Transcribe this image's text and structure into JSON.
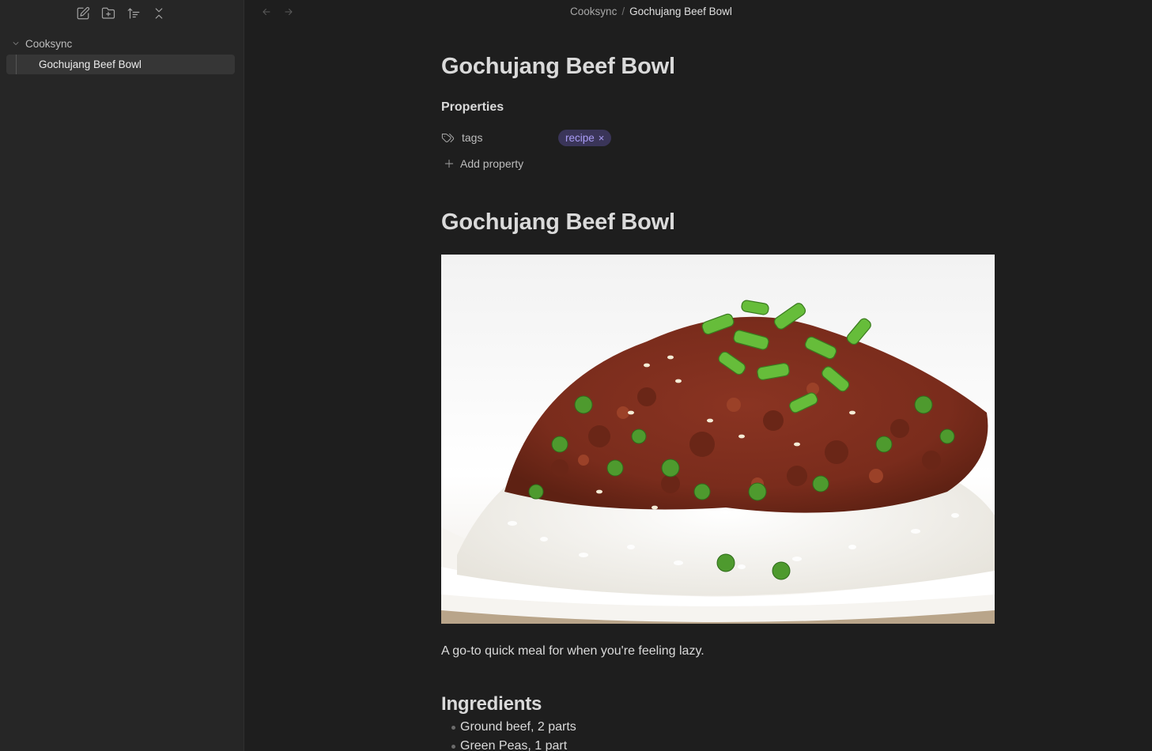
{
  "sidebar": {
    "toolbar": [
      {
        "icon": "new-note-icon"
      },
      {
        "icon": "new-folder-icon"
      },
      {
        "icon": "sort-icon"
      },
      {
        "icon": "collapse-all-icon"
      }
    ],
    "folder": {
      "label": "Cooksync",
      "expanded": true
    },
    "files": [
      {
        "label": "Gochujang Beef Bowl",
        "active": true
      }
    ]
  },
  "header": {
    "breadcrumb": {
      "parent": "Cooksync",
      "separator": "/",
      "current": "Gochujang Beef Bowl"
    }
  },
  "note": {
    "inline_title": "Gochujang Beef Bowl",
    "properties": {
      "heading": "Properties",
      "rows": [
        {
          "key": "tags",
          "icon": "tags-icon",
          "values": [
            "recipe"
          ]
        }
      ],
      "remove_glyph": "×",
      "add_label": "Add property"
    },
    "heading": "Gochujang Beef Bowl",
    "image": {
      "alt": "gochujang-beef-bowl-photo"
    },
    "description": "A go-to quick meal for when you're feeling lazy.",
    "ingredients_heading": "Ingredients",
    "ingredients": [
      "Ground beef, 2 parts",
      "Green Peas, 1 part"
    ]
  },
  "colors": {
    "background": "#1e1e1e",
    "sidebar": "#262626",
    "tag_bg": "#3a3559",
    "tag_text": "#a99cf5"
  }
}
